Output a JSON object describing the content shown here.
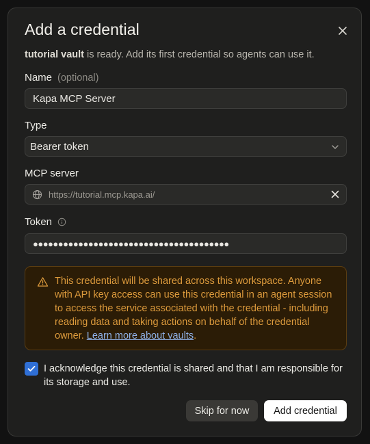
{
  "dialog": {
    "title": "Add a credential",
    "subtitle_vault": "tutorial vault",
    "subtitle_rest": " is ready. Add its first credential so agents can use it."
  },
  "name_field": {
    "label": "Name",
    "optional": "(optional)",
    "value": "Kapa MCP Server"
  },
  "type_field": {
    "label": "Type",
    "selected": "Bearer token"
  },
  "mcp_field": {
    "label": "MCP server",
    "value": "https://tutorial.mcp.kapa.ai/"
  },
  "token_field": {
    "label": "Token",
    "masked_value": "●●●●●●●●●●●●●●●●●●●●●●●●●●●●●●●●●●●●●●●"
  },
  "warning": {
    "text": "This credential will be shared across this workspace. Anyone with API key access can use this credential in an agent session to access the service associated with the credential - including reading data and taking actions on behalf of the credential owner. ",
    "link": "Learn more about vaults",
    "suffix": "."
  },
  "acknowledge": {
    "checked": true,
    "text": "I acknowledge this credential is shared and that I am responsible for its storage and use."
  },
  "buttons": {
    "skip": "Skip for now",
    "add": "Add credential"
  },
  "colors": {
    "accent": "#2f6fd6",
    "warning_text": "#dc9a3c",
    "warning_bg": "#2b1c06",
    "link": "#8fb1e6"
  }
}
